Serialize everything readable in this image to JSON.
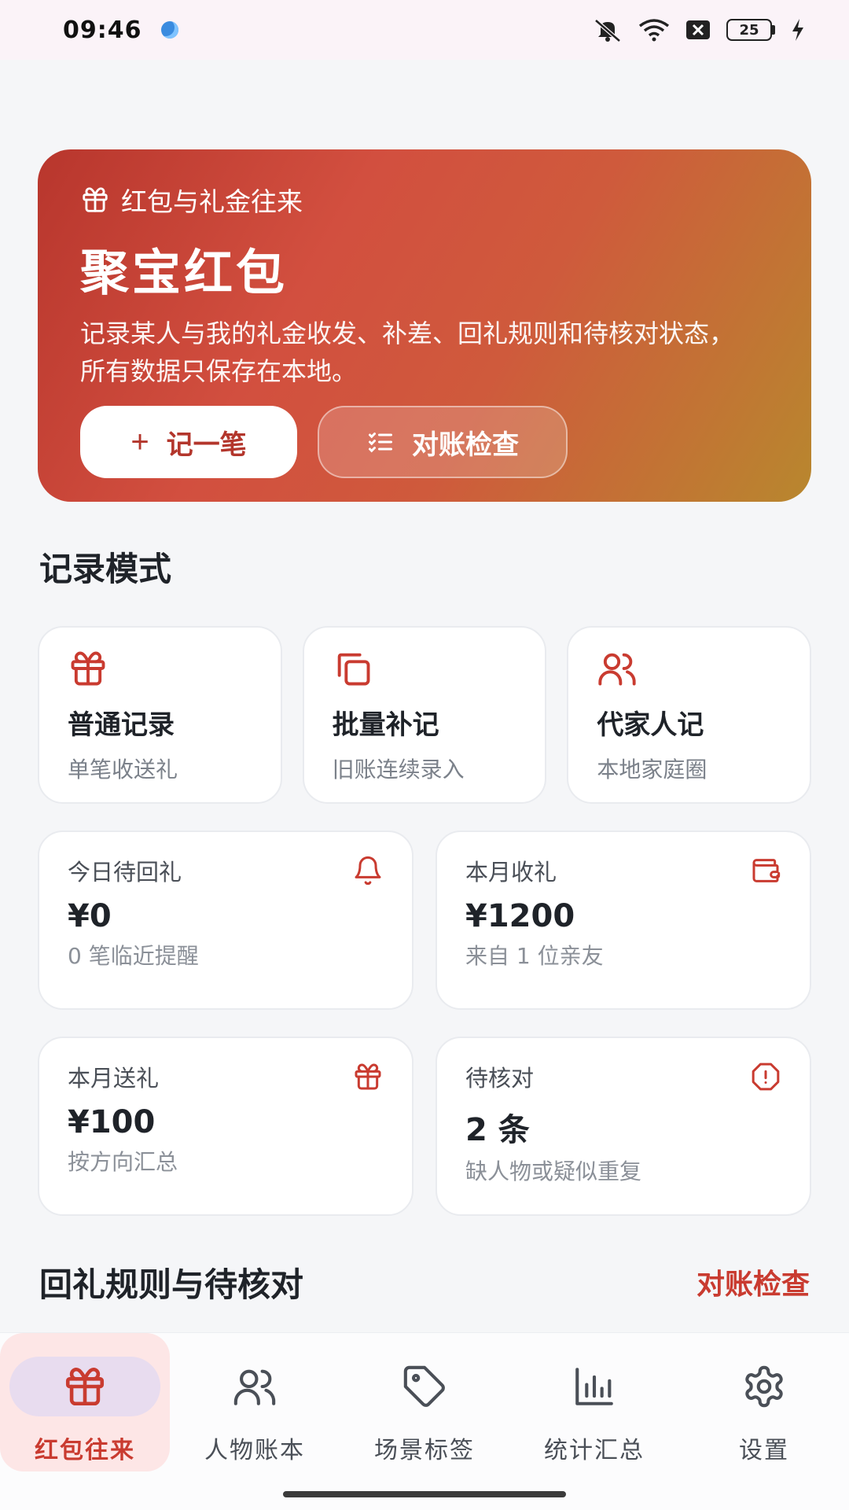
{
  "status_bar": {
    "time": "09:46",
    "battery": "25"
  },
  "hero": {
    "eyebrow": "红包与礼金往来",
    "title": "聚宝红包",
    "description": "记录某人与我的礼金收发、补差、回礼规则和待核对状态，所有数据只保存在本地。",
    "primary_button": "记一笔",
    "secondary_button": "对账检查"
  },
  "modes": {
    "section_title": "记录模式",
    "items": [
      {
        "title": "普通记录",
        "subtitle": "单笔收送礼",
        "icon": "gift-icon"
      },
      {
        "title": "批量补记",
        "subtitle": "旧账连续录入",
        "icon": "copy-icon"
      },
      {
        "title": "代家人记",
        "subtitle": "本地家庭圈",
        "icon": "users-icon"
      }
    ]
  },
  "stats": [
    {
      "label": "今日待回礼",
      "value": "¥0",
      "note": "0 笔临近提醒",
      "icon": "bell-icon"
    },
    {
      "label": "本月收礼",
      "value": "¥1200",
      "note": "来自 1 位亲友",
      "icon": "wallet-icon"
    },
    {
      "label": "本月送礼",
      "value": "¥100",
      "note": "按方向汇总",
      "icon": "gift-icon"
    },
    {
      "label": "待核对",
      "value": "2 条",
      "note": "缺人物或疑似重复",
      "icon": "alert-icon"
    }
  ],
  "rules": {
    "section_title": "回礼规则与待核对",
    "link": "对账检查"
  },
  "nav": {
    "items": [
      {
        "label": "红包往来",
        "icon": "gift-icon",
        "active": true
      },
      {
        "label": "人物账本",
        "icon": "users-icon",
        "active": false
      },
      {
        "label": "场景标签",
        "icon": "tag-icon",
        "active": false
      },
      {
        "label": "统计汇总",
        "icon": "bar-chart-icon",
        "active": false
      },
      {
        "label": "设置",
        "icon": "gear-icon",
        "active": false
      }
    ]
  },
  "colors": {
    "accent": "#c93b30",
    "background": "#f5f6f8"
  }
}
